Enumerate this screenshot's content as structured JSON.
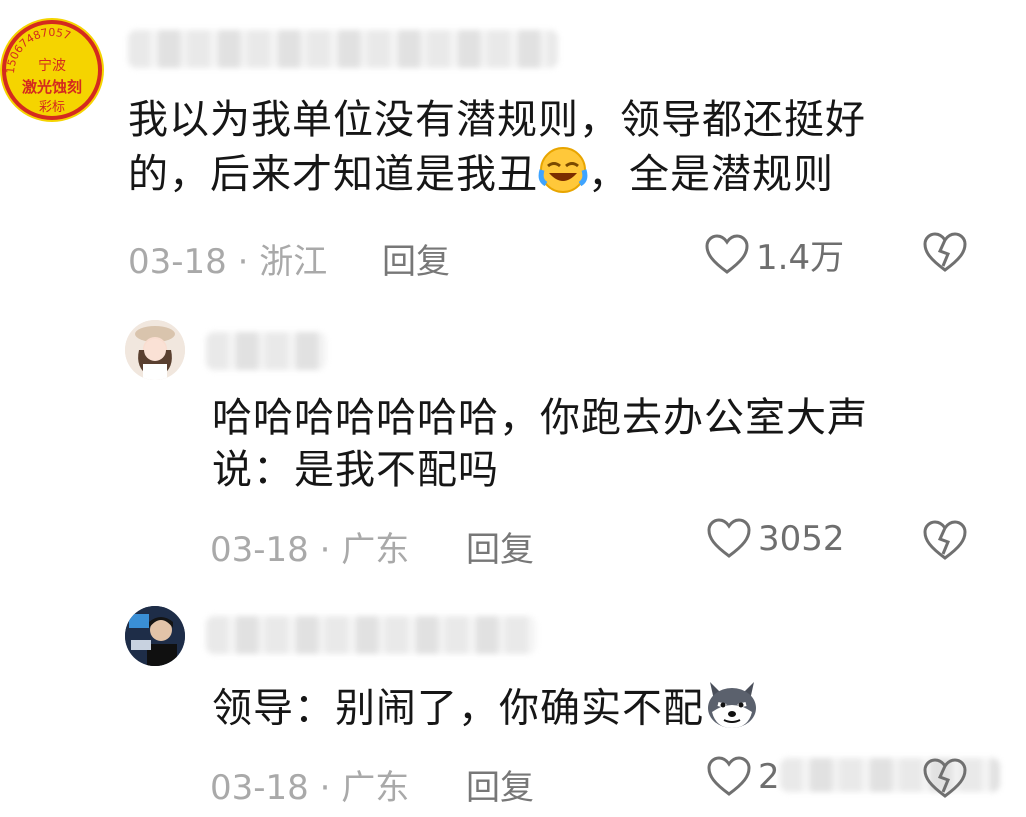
{
  "comments": [
    {
      "avatar_lines": [
        "15067487057",
        "宁波",
        "激光蚀刻",
        "彩标"
      ],
      "text_lines": [
        "我以为我单位没有潜规则，领导都还挺好",
        "的，后来才知道是我丑",
        "，全是潜规则"
      ],
      "emoji": "laughing-crying-emoji",
      "date_location": "03-18 · 浙江",
      "reply_label": "回复",
      "like_count": "1.4万"
    },
    {
      "text_lines": [
        "哈哈哈哈哈哈哈，你跑去办公室大声",
        "说：是我不配吗"
      ],
      "date_location": "03-18 · 广东",
      "reply_label": "回复",
      "like_count": "3052"
    },
    {
      "text_lines": [
        "领导：别闹了，你确实不配"
      ],
      "emoji": "husky-emoji",
      "date_location": "03-18 · 广东",
      "reply_label": "回复",
      "like_count": "2"
    }
  ],
  "colors": {
    "meta": "#a9a9a9",
    "reply": "#777777",
    "seal": "#d42a1e",
    "seal_bg": "#f5d400"
  }
}
